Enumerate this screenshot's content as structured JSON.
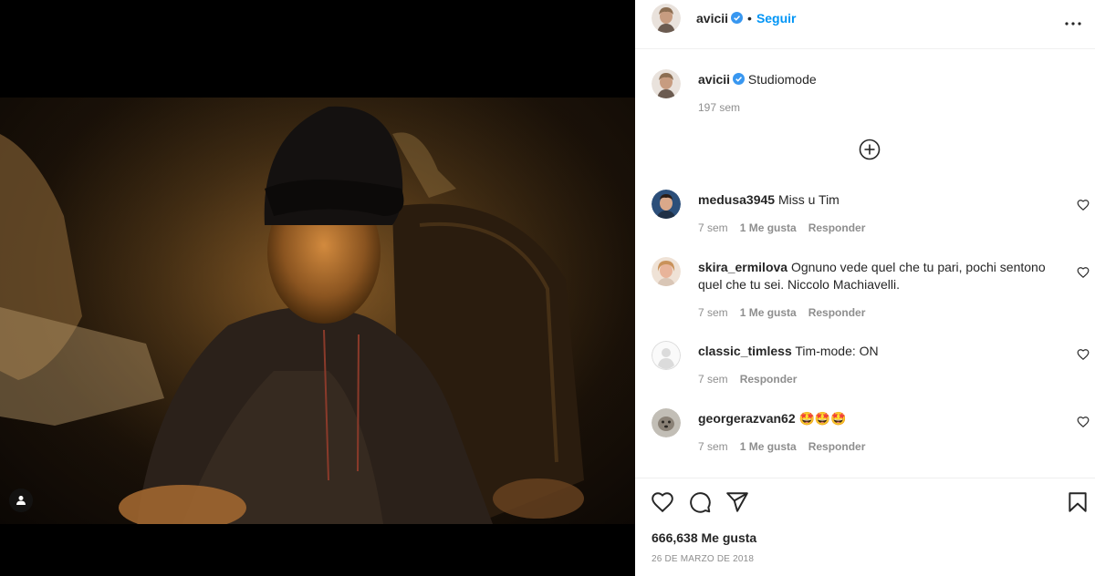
{
  "post": {
    "author": "avicii",
    "follow_label": "Seguir",
    "dot": "•",
    "caption": "Studiomode",
    "caption_time": "197 sem",
    "likes": "666,638 Me gusta",
    "date": "26 DE MARZO DE 2018"
  },
  "comments": [
    {
      "user": "medusa3945",
      "text": "Miss u Tim",
      "time": "7 sem",
      "likes": "1 Me gusta",
      "reply": "Responder"
    },
    {
      "user": "skira_ermilova",
      "text": "Ognuno vede quel che tu pari, pochi sentono quel che tu sei. Niccolo Machiavelli.",
      "time": "7 sem",
      "likes": "1 Me gusta",
      "reply": "Responder"
    },
    {
      "user": "classic_timless",
      "text": "Tim-mode: ON",
      "time": "7 sem",
      "reply": "Responder"
    },
    {
      "user": "georgerazvan62",
      "text": "🤩🤩🤩",
      "time": "7 sem",
      "likes": "1 Me gusta",
      "reply": "Responder"
    }
  ],
  "icons": {
    "verified": "verified-badge-icon",
    "more": "more-options-icon",
    "add": "load-more-comments-icon",
    "heart": "heart-icon",
    "comment": "comment-icon",
    "share": "share-icon",
    "save": "bookmark-icon",
    "tag": "user-tag-icon"
  },
  "colors": {
    "accent": "#0095f6",
    "muted": "#8e8e8e",
    "text": "#262626"
  }
}
